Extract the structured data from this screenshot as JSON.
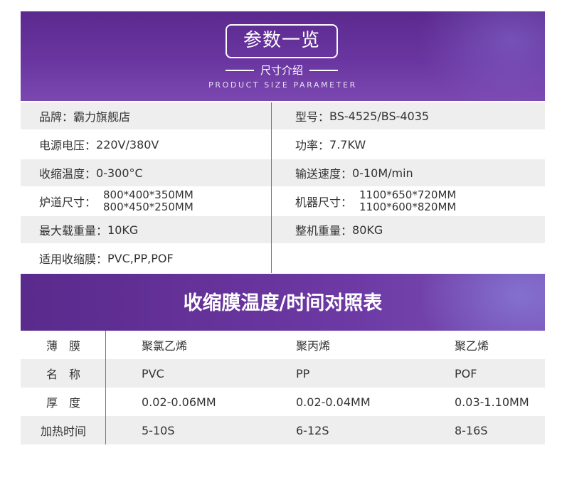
{
  "header": {
    "title": "参数一览",
    "subtitle": "尺寸介绍",
    "english": "PRODUCT SIZE PARAMETER"
  },
  "params": {
    "rows": [
      {
        "left": {
          "label": "品牌：",
          "value": "霸力旗舰店"
        },
        "right": {
          "label": "型号：",
          "value": "BS-4525/BS-4035"
        }
      },
      {
        "left": {
          "label": "电源电压：",
          "value": "220V/380V"
        },
        "right": {
          "label": "功率：",
          "value": "7.7KW"
        }
      },
      {
        "left": {
          "label": "收缩温度：",
          "value": "0-300°C"
        },
        "right": {
          "label": "输送速度：",
          "value": "0-10M/min"
        }
      },
      {
        "left": {
          "label": "炉道尺寸：",
          "value1": "800*400*350MM",
          "value2": "800*450*250MM"
        },
        "right": {
          "label": "机器尺寸：",
          "value1": "1100*650*720MM",
          "value2": "1100*600*820MM"
        }
      },
      {
        "left": {
          "label": "最大载重量：",
          "value": "10KG"
        },
        "right": {
          "label": "整机重量：",
          "value": "80KG"
        }
      },
      {
        "left": {
          "label": "适用收缩膜：",
          "value": "PVC,PP,POF"
        },
        "right": {
          "label": "",
          "value": ""
        }
      }
    ]
  },
  "film_section": {
    "title": "收缩膜温度/时间对照表",
    "rows": [
      {
        "head": "薄　膜",
        "c1": "聚氯乙烯",
        "c2": "聚丙烯",
        "c3": "聚乙烯"
      },
      {
        "head": "名　称",
        "c1": "PVC",
        "c2": "PP",
        "c3": "POF"
      },
      {
        "head": "厚　度",
        "c1": "0.02-0.06MM",
        "c2": "0.02-0.04MM",
        "c3": "0.03-1.10MM"
      },
      {
        "head": "加热时间",
        "c1": "5-10S",
        "c2": "6-12S",
        "c3": "8-16S"
      }
    ]
  },
  "colors": {
    "banner": "#6a35a0",
    "row_gray": "#eeeeee",
    "text": "#333333"
  }
}
